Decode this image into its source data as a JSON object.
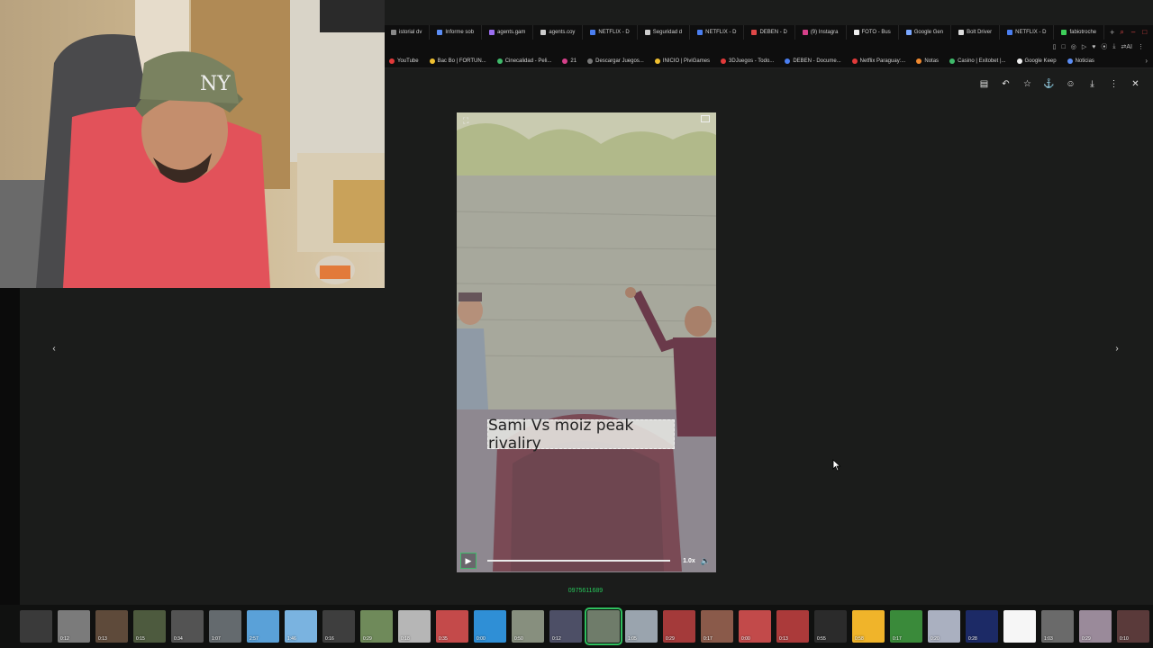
{
  "browser": {
    "tabs": [
      {
        "label": "istorial dv",
        "color": "#888888"
      },
      {
        "label": "Informe sob",
        "color": "#5b8df5"
      },
      {
        "label": "agents.gam",
        "color": "#9b6ef0"
      },
      {
        "label": "agents.coy",
        "color": "#cccccc"
      },
      {
        "label": "NETFLIX - D",
        "color": "#4a7ef0"
      },
      {
        "label": "Seguridad d",
        "color": "#cccccc"
      },
      {
        "label": "NETFLIX - D",
        "color": "#4a7ef0"
      },
      {
        "label": "DEBEN - D",
        "color": "#e04848"
      },
      {
        "label": "(9) Instagra",
        "color": "#d6408a"
      },
      {
        "label": "FOTO - Bus",
        "color": "#eeeeee"
      },
      {
        "label": "Google Gen",
        "color": "#7aa7ff"
      },
      {
        "label": "Bolt Driver",
        "color": "#dddddd"
      },
      {
        "label": "NETFLIX - D",
        "color": "#4a7ef0"
      },
      {
        "label": "fabiotroche",
        "color": "#3ecf5a"
      }
    ],
    "new_tab": "+",
    "window_controls": [
      "⌕",
      "–",
      "□",
      "✕"
    ],
    "toolbar_icons": [
      "▯",
      "□",
      "◎",
      "▷",
      "♥",
      "⦿",
      "⤓",
      "⇄AI",
      "⋮"
    ],
    "bookmarks": [
      {
        "label": "YouTube",
        "color": "#e23a3a"
      },
      {
        "label": "Bac Bo | FORTUN...",
        "color": "#f0c030"
      },
      {
        "label": "Cinecalidad - Peli...",
        "color": "#3fb96a"
      },
      {
        "label": "21",
        "color": "#d6408a"
      },
      {
        "label": "Descargar Juegos...",
        "color": "#777777"
      },
      {
        "label": "INICIO | PiviGames",
        "color": "#f0c030"
      },
      {
        "label": "3DJuegos - Todo...",
        "color": "#e23a3a"
      },
      {
        "label": "DEBEN - Docume...",
        "color": "#4a7ef0"
      },
      {
        "label": "Netflix Paraguay:...",
        "color": "#e23a3a"
      },
      {
        "label": "Notas",
        "color": "#f08a30"
      },
      {
        "label": "Casino | Exitobet |...",
        "color": "#3fb96a"
      },
      {
        "label": "Google Keep",
        "color": "#eeeeee"
      },
      {
        "label": "Noticias",
        "color": "#5b8df5"
      }
    ],
    "bookmarks_more": "›"
  },
  "viewer": {
    "actions": [
      "▤",
      "↶",
      "☆",
      "⚓",
      "☺",
      "⤓",
      "⋮",
      "✕"
    ],
    "prev": "‹",
    "next": "›",
    "video": {
      "caption": "Sami Vs moiz peak rivaliry",
      "speed": "1.0x",
      "play_icon": "▶",
      "volume_icon": "🔈",
      "expand_icon": "⛶"
    },
    "phone_number": "0975611689"
  },
  "filmstrip": {
    "durations": [
      "",
      "0:12",
      "0:13",
      "0:15",
      "0:34",
      "1:07",
      "2:57",
      "1:46",
      "0:16",
      "0:29",
      "0:18",
      "0:35",
      "0:00",
      "0:50",
      "0:12",
      "",
      "1:05",
      "0:29",
      "0:17",
      "0:00",
      "0:13",
      "0:55",
      "0:58",
      "0:17",
      "0:20",
      "0:28",
      "",
      "1:03",
      "0:29",
      "0:10"
    ],
    "colors": [
      "#3a3a3a",
      "#7b7b7b",
      "#5e4a3a",
      "#4d5a3e",
      "#535353",
      "#646a6e",
      "#5aa1d8",
      "#7ab3e0",
      "#3e3e3e",
      "#6f8a5a",
      "#b6b6b6",
      "#c44a4a",
      "#2f8fd6",
      "#878f7e",
      "#4d4f66",
      "#6f7c6a",
      "#9aa4ae",
      "#a43a3a",
      "#8a5a4a",
      "#c24a4a",
      "#ab3a3a",
      "#2b2b2b",
      "#f0b42a",
      "#3a8a3a",
      "#aab0c0",
      "#1c2a66",
      "#f6f6f6",
      "#6a6a6a",
      "#9a8a9a",
      "#5a3a3a"
    ],
    "selected_index": 15
  }
}
